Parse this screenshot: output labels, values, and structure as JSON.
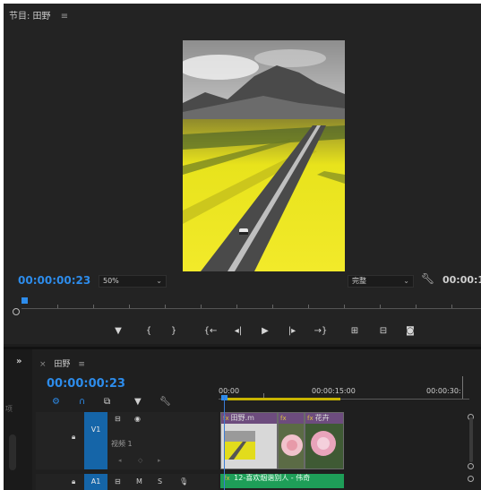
{
  "program_monitor": {
    "title": "节目: 田野",
    "menu_icon": "hamburger-icon",
    "timecode": "00:00:00:23",
    "zoom": "50%",
    "quality": "完整",
    "duration": "00:00:1"
  },
  "transport": {
    "buttons": [
      "add-marker-icon",
      "mark-in-icon",
      "mark-out-icon",
      "go-to-in-icon",
      "step-back-icon",
      "play-icon",
      "step-forward-icon",
      "go-to-out-icon",
      "insert-icon",
      "overwrite-icon",
      "export-frame-icon"
    ]
  },
  "timeline": {
    "expand": "»",
    "tab": {
      "close": "×",
      "name": "田野",
      "menu": "≡"
    },
    "timecode": "00:00:00:23",
    "ruler": [
      "00:00",
      "00:00:15:00",
      "00:00:30:"
    ],
    "side_label": "项",
    "tracks": {
      "v1": {
        "id": "V1",
        "name": "视频 1"
      },
      "a1": {
        "id": "A1",
        "m": "M",
        "s": "S"
      }
    },
    "clips": {
      "video1": {
        "fx": "fx",
        "label": "田野.m"
      },
      "video2": {
        "fx": "fx",
        "label": ""
      },
      "video3": {
        "fx": "fx",
        "label": "花卉"
      },
      "audio": {
        "fx": "fx",
        "label": "12-喜欢烟谐别人 - 伟奇"
      }
    }
  },
  "colors": {
    "accent": "#2d8ceb",
    "track_blue": "#1565a8",
    "audio_green": "#1e9e58"
  }
}
